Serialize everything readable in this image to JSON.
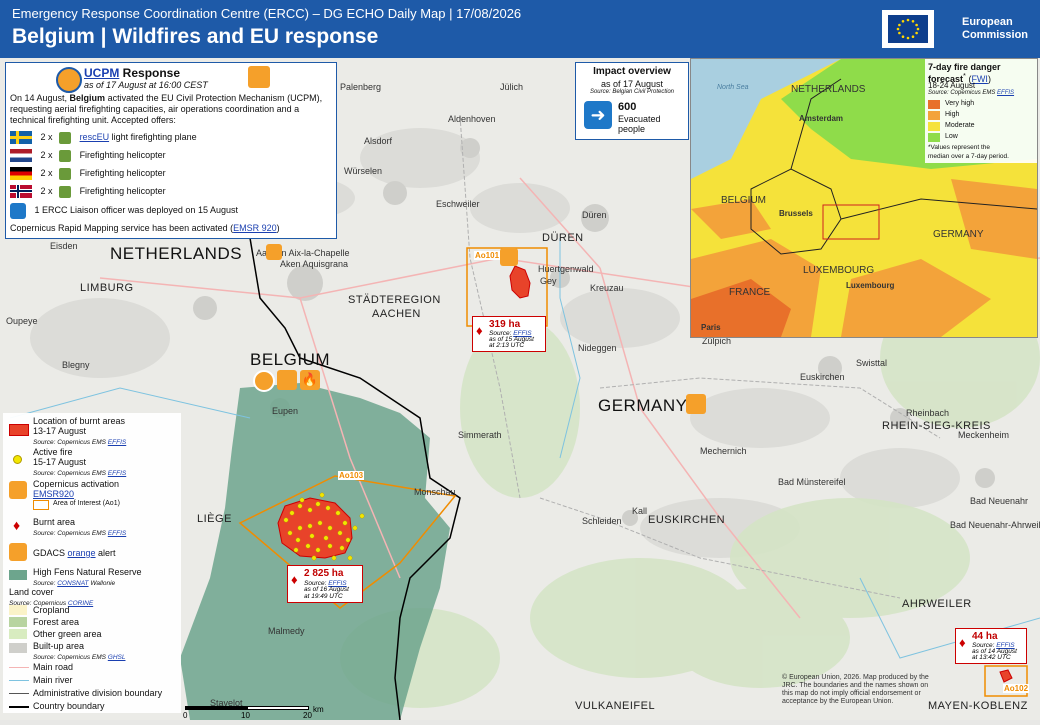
{
  "header": {
    "supertitle": "Emergency Response Coordination Centre (ERCC) – DG ECHO Daily Map | 17/08/2026",
    "title": "Belgium | Wildfires and EU response",
    "ec_logo_text_1": "European",
    "ec_logo_text_2": "Commission"
  },
  "map_labels": {
    "countries": [
      "NETHERLANDS",
      "BELGIUM",
      "GERMANY"
    ],
    "regions": [
      "STÄDTEREGION",
      "AACHEN",
      "DÜREN",
      "EUSKIRCHEN",
      "RHEIN-SIEG-KREIS",
      "AHRWEILER",
      "VULKANEIFEL",
      "MAYEN-KOBLENZ",
      "LIMBURG",
      "LIÈGE"
    ],
    "cities": [
      "Palenberg",
      "Jülich",
      "Aldenhoven",
      "Alsdorf",
      "Würselen",
      "Eschweiler",
      "Düren",
      "Eisden",
      "Aachen Aix-la-Chapelle",
      "Aken Aquisgrana",
      "Huertgenwald",
      "Gey",
      "Kreuzau",
      "Oupeye",
      "Blegny",
      "Eupen",
      "Nideggen",
      "Zülpich",
      "Swisttal",
      "Euskirchen",
      "Simmerath",
      "Mechernich",
      "Rheinbach",
      "Meckenheim",
      "Bad Münstereifel",
      "Monschau",
      "Schleiden",
      "Kall",
      "Bad Neuenahr",
      "Bad Neuenahr-Ahrweiler",
      "Malmedy",
      "Stavelot"
    ]
  },
  "ucpm": {
    "title_link": "UCPM",
    "title_rest": " Response",
    "as_of": "as of 17 August at 16:00 CEST",
    "body_p1": "On 14 August, ",
    "body_bold": "Belgium",
    "body_p2": " activated the EU Civil Protection Mechanism (UCPM), requesting aerial firefighting capacities, air operations coordination and a technical firefighting unit. Accepted offers:",
    "offers": [
      {
        "country": "Sweden",
        "count": "2 x",
        "link": "rescEU",
        "label": " light firefighting plane"
      },
      {
        "country": "Netherlands",
        "count": "2 x",
        "link": "",
        "label": "Firefighting helicopter"
      },
      {
        "country": "Germany",
        "count": "2 x",
        "link": "",
        "label": "Firefighting helicopter"
      },
      {
        "country": "Norway",
        "count": "2 x",
        "link": "",
        "label": "Firefighting helicopter"
      }
    ],
    "liaison": "1 ERCC Liaison officer was deployed on 15 August",
    "copernicus_p1": "Copernicus Rapid Mapping service has been activated (",
    "copernicus_link": "EMSR 920",
    "copernicus_p2": ")"
  },
  "impact": {
    "title": "Impact overview",
    "as_of": "as of 17 August",
    "source": "Source: Belgian Civil Protection",
    "count": "600",
    "label_1": "Evacuated",
    "label_2": "people"
  },
  "fwi_inset": {
    "title_1": "7-day fire danger",
    "title_2": "forecast",
    "title_link": "FWI",
    "dates": "18-24 August",
    "source_p": "Source: Copernicus EMS ",
    "source_link": "EFFIS",
    "classes": [
      {
        "label": "Very high",
        "color": "#e8702a"
      },
      {
        "label": "High",
        "color": "#f3a33a"
      },
      {
        "label": "Moderate",
        "color": "#f5e23a"
      },
      {
        "label": "Low",
        "color": "#8fdc4a"
      }
    ],
    "note_1": "*Values represent the",
    "note_2": "median over a 7-day period.",
    "labels": [
      "North Sea",
      "NETHERLANDS",
      "Amsterdam",
      "BELGIUM",
      "Brussels",
      "GERMANY",
      "LUXEMBOURG",
      "Luxembourg",
      "FRANCE",
      "Paris"
    ]
  },
  "callouts": [
    {
      "ha": "319 ha",
      "src_p": "Source: ",
      "src_link": "EFFIS",
      "asof_1": "as of 15 August",
      "asof_2": "at 2:13 UTC"
    },
    {
      "ha": "2 825 ha",
      "src_p": "Source: ",
      "src_link": "EFFIS",
      "asof_1": "as of 16 August",
      "asof_2": "at 19:49 UTC"
    },
    {
      "ha": "44 ha",
      "src_p": "Source: ",
      "src_link": "EFFIS",
      "asof_1": "as of 14 August",
      "asof_2": "at 13:42 UTC"
    }
  ],
  "aoi_labels": [
    "Ao101",
    "Ao103",
    "Ao102"
  ],
  "legend": {
    "burnt_title_1": "Location of burnt areas",
    "burnt_title_2": "13-17 August",
    "burnt_src": "Source: Copernicus EMS ",
    "active_1": "Active fire",
    "active_2": "15-17 August",
    "active_src": "Source: Copernicus EMS ",
    "effis": "EFFIS",
    "cop_act": "Copernicus activation",
    "cop_link": "EMSR920",
    "aoi": "Area of Interest (Ao1)",
    "burnt_area": "Burnt area",
    "burnt_area_src": "Source: Copernicus EMS ",
    "gdacs_1": "GDACS ",
    "gdacs_link": "orange",
    "gdacs_2": " alert",
    "fens": "High Fens Natural Reserve",
    "fens_src": "Source: ",
    "fens_link": "CONSNAT",
    "fens_src2": " Wallonie",
    "landcover": "Land cover",
    "landcover_src": "Source: Copernicus ",
    "landcover_link": "CORINE",
    "cropland": "Cropland",
    "forest": "Forest area",
    "green": "Other green area",
    "builtup": "Built-up area",
    "builtup_src": "Source: Copernicus EMS ",
    "builtup_link": "GHSL",
    "road": "Main road",
    "river": "Main river",
    "admin": "Administrative division boundary",
    "country": "Country boundary"
  },
  "scale": {
    "zero": "0",
    "mid": "10",
    "end": "20",
    "unit": "km"
  },
  "copyright": "© European Union, 2026. Map produced by the JRC. The boundaries and the names shown on this map do not imply official endorsement or acceptance by the European Union.",
  "colors": {
    "header": "#1e5aa8",
    "burnt": "#e8432a",
    "forest": "#5a9a80",
    "aoi": "#f08c00"
  }
}
